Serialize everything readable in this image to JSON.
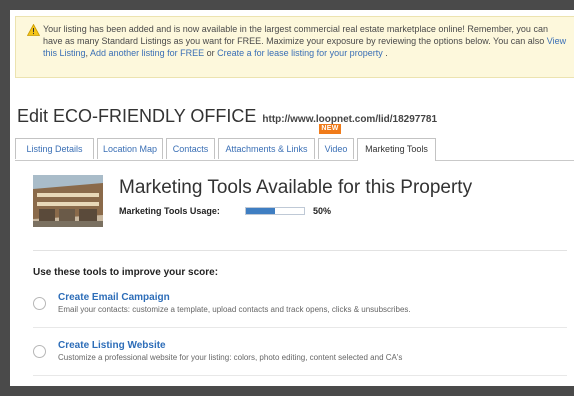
{
  "alert": {
    "text_1": "Your listing has been added and is now available in the largest commercial real estate marketplace online! Remember, you can have as many Standard Listings as you want for FREE. Maximize your exposure by reviewing the options below. You can also ",
    "link_view": "View this Listing",
    "sep_1": ", ",
    "link_add": "Add another listing for FREE",
    "sep_2": " or ",
    "link_lease": "Create a for lease listing for your property",
    "end": " ."
  },
  "header": {
    "title": "Edit ECO-FRIENDLY OFFICE",
    "url": "http://www.loopnet.com/lid/18297781"
  },
  "new_badge": "NEW",
  "tabs": [
    {
      "label": "Listing Details"
    },
    {
      "label": "Location Map"
    },
    {
      "label": "Contacts"
    },
    {
      "label": "Attachments & Links"
    },
    {
      "label": "Video"
    },
    {
      "label": "Marketing Tools",
      "active": true
    }
  ],
  "marketing": {
    "title": "Marketing Tools Available for this Property",
    "usage_label": "Marketing Tools Usage:",
    "usage_fraction": 0.5,
    "usage_text": "50%",
    "improve_heading": "Use these tools to improve your score:"
  },
  "tools": [
    {
      "name": "Create Email Campaign",
      "desc": "Email your contacts: customize a template, upload contacts and track opens, clicks & unsubscribes."
    },
    {
      "name": "Create Listing Website",
      "desc": "Customize a professional website for your listing: colors, photo editing, content selected and CA's"
    }
  ],
  "colors": {
    "link": "#3a6fb5",
    "tool_link": "#2d6db8",
    "alert_bg": "#fdf8dc",
    "badge": "#f07b1a",
    "bar_fill": "#3f7ec2"
  },
  "icons": {
    "warning": "warning-icon"
  }
}
